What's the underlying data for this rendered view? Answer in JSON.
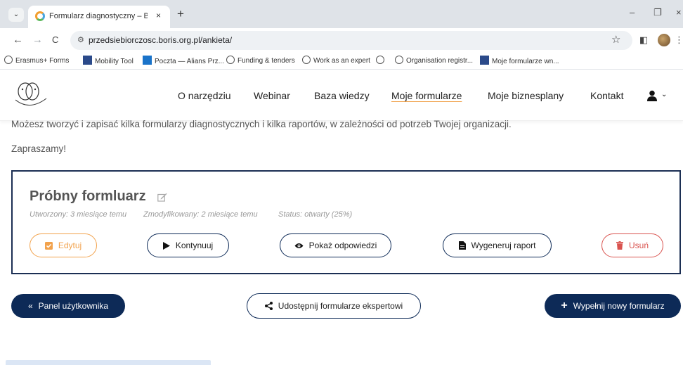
{
  "browser": {
    "tab_title": "Formularz diagnostyczny – BOR",
    "tab_close": "×",
    "new_tab": "+",
    "url": "przedsiebiorczosc.boris.org.pl/ankieta/",
    "window_controls": {
      "minimize": "–",
      "restore": "❐",
      "close": "×"
    },
    "nav": {
      "back": "←",
      "forward": "→",
      "reload": "C"
    },
    "bookmarks": [
      {
        "label": "Erasmus+ Forms",
        "icon": "globe-icon"
      },
      {
        "label": "Mobility Tool",
        "icon": "eu-icon"
      },
      {
        "label": "Poczta — Alians Prz...",
        "icon": "outlook-icon"
      },
      {
        "label": "Funding & tenders",
        "icon": "globe-icon"
      },
      {
        "label": "Work as an expert",
        "icon": "globe-icon"
      },
      {
        "label": "",
        "icon": "globe-icon"
      },
      {
        "label": "Organisation registr...",
        "icon": "globe-icon"
      },
      {
        "label": "Moje formularze wn...",
        "icon": "eu-icon"
      }
    ]
  },
  "site": {
    "nav": [
      {
        "label": "O narzędziu",
        "active": false
      },
      {
        "label": "Webinar",
        "active": false
      },
      {
        "label": "Baza wiedzy",
        "active": false
      },
      {
        "label": "Moje formularze",
        "active": true
      },
      {
        "label": "Moje biznesplany",
        "active": false
      },
      {
        "label": "Kontakt",
        "active": false
      }
    ],
    "accent_color": "#f0a24a",
    "primary_color": "#0d2a57"
  },
  "content": {
    "intro_text": "Możesz tworzyć i zapisać kilka formularzy diagnostycznych i kilka raportów, w zależności od potrzeb Twojej organizacji.",
    "invite_text": "Zapraszamy!",
    "form": {
      "title": "Próbny formluarz",
      "created": "Utworzony: 3 miesiące temu",
      "modified": "Zmodyfikowany: 2 miesiące temu",
      "status": "Status: otwarty (25%)",
      "progress_percent": 25,
      "actions": {
        "edit": "Edytuj",
        "continue": "Kontynuuj",
        "show_answers": "Pokaż odpowiedzi",
        "generate_report": "Wygeneruj raport",
        "delete": "Usuń"
      }
    },
    "bottom_actions": {
      "user_panel": "Panel użytkownika",
      "share": "Udostępnij formularze ekspertowi",
      "new_form": "Wypełnij nowy formularz"
    }
  }
}
